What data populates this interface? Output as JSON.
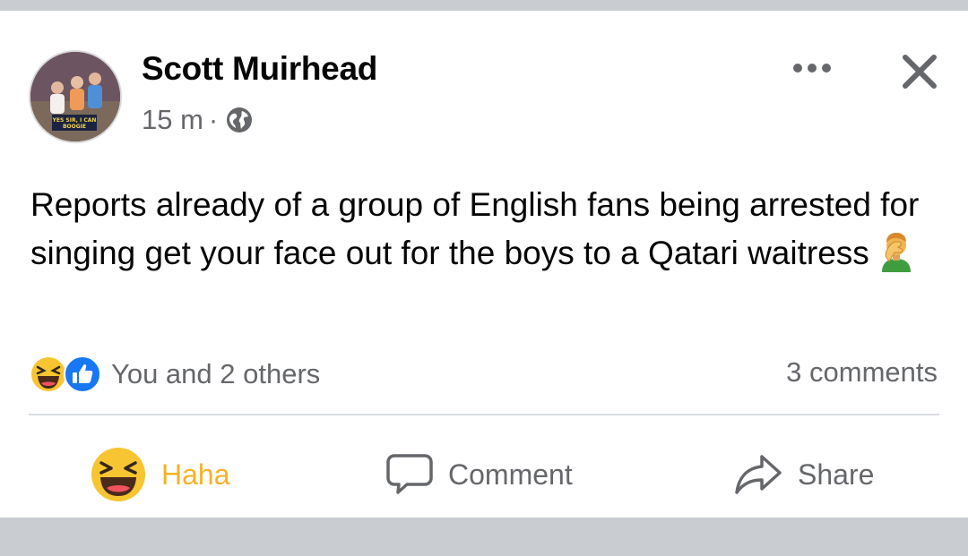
{
  "post": {
    "author": "Scott Muirhead",
    "timestamp": "15 m",
    "separator": "·",
    "audience_icon": "globe-icon",
    "text": "Reports already of a group of English fans being arrested for singing get your face out for the boys to a Qatari waitress",
    "emoji": "facepalm-icon",
    "avatar_badge": "YES SIR, I CAN BOOGIE"
  },
  "reactions": {
    "icons": [
      "haha-icon",
      "like-icon"
    ],
    "summary": "You and 2 others",
    "comments": "3 comments"
  },
  "actions": {
    "haha_label": "Haha",
    "comment_label": "Comment",
    "share_label": "Share"
  },
  "colors": {
    "haha_accent": "#f7b125",
    "like_blue": "#1877f2",
    "secondary_text": "#65676b"
  }
}
